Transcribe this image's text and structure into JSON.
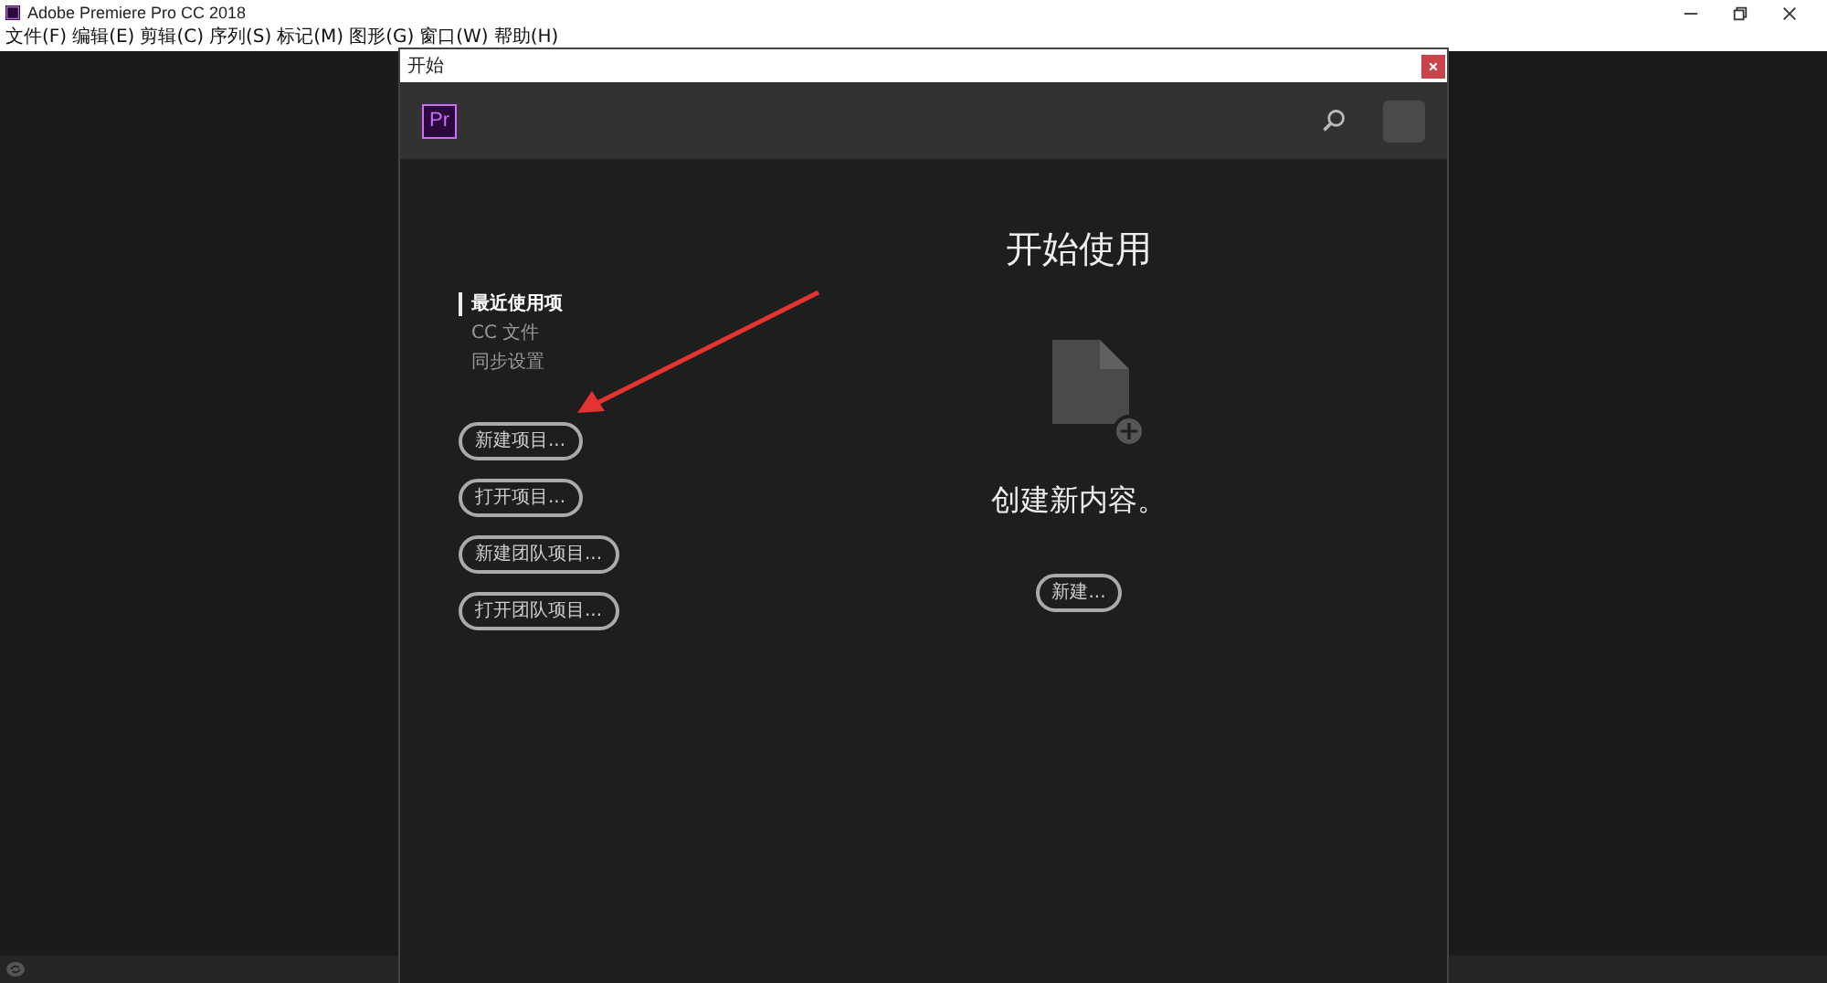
{
  "app": {
    "title": "Adobe Premiere Pro CC 2018"
  },
  "menu": [
    "文件(F)",
    "编辑(E)",
    "剪辑(C)",
    "序列(S)",
    "标记(M)",
    "图形(G)",
    "窗口(W)",
    "帮助(H)"
  ],
  "dialog": {
    "title": "开始",
    "logo": "Pr",
    "nav": [
      {
        "label": "最近使用项",
        "selected": true
      },
      {
        "label": "CC 文件",
        "selected": false
      },
      {
        "label": "同步设置",
        "selected": false
      }
    ],
    "buttons": [
      "新建项目...",
      "打开项目...",
      "新建团队项目...",
      "打开团队项目..."
    ],
    "heading": "开始使用",
    "message": "创建新内容。",
    "new_button": "新建..."
  }
}
